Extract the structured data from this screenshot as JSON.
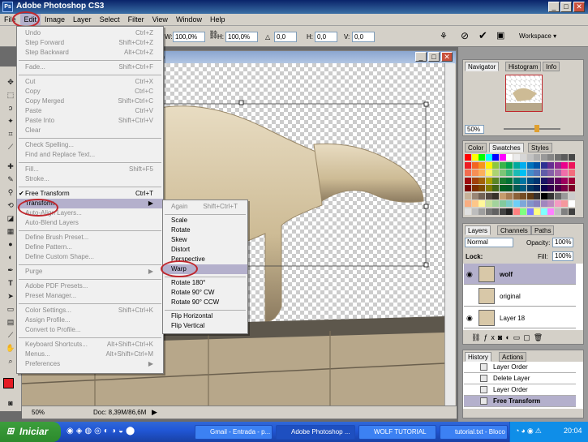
{
  "app": {
    "title": "Adobe Photoshop CS3",
    "ps_badge": "Ps"
  },
  "menubar": [
    "File",
    "Edit",
    "Image",
    "Layer",
    "Select",
    "Filter",
    "View",
    "Window",
    "Help"
  ],
  "options": {
    "w_label": "W:",
    "w_value": "100,0%",
    "h_label": "H:",
    "h_value": "100,0%",
    "angle_label": "△",
    "angle_value": "0,0",
    "hskew_label": "H:",
    "hskew_value": "0,0",
    "vskew_label": "V:",
    "vskew_value": "0,0",
    "workspace": "Workspace ▾"
  },
  "edit_menu": [
    {
      "label": "Undo",
      "sc": "Ctrl+Z",
      "en": false
    },
    {
      "label": "Step Forward",
      "sc": "Shift+Ctrl+Z",
      "en": false
    },
    {
      "label": "Step Backward",
      "sc": "Alt+Ctrl+Z",
      "en": false
    },
    {
      "sep": true
    },
    {
      "label": "Fade...",
      "sc": "Shift+Ctrl+F",
      "en": false
    },
    {
      "sep": true
    },
    {
      "label": "Cut",
      "sc": "Ctrl+X",
      "en": false
    },
    {
      "label": "Copy",
      "sc": "Ctrl+C",
      "en": false
    },
    {
      "label": "Copy Merged",
      "sc": "Shift+Ctrl+C",
      "en": false
    },
    {
      "label": "Paste",
      "sc": "Ctrl+V",
      "en": false
    },
    {
      "label": "Paste Into",
      "sc": "Shift+Ctrl+V",
      "en": false
    },
    {
      "label": "Clear",
      "sc": "",
      "en": false
    },
    {
      "sep": true
    },
    {
      "label": "Check Spelling...",
      "sc": "",
      "en": false
    },
    {
      "label": "Find and Replace Text...",
      "sc": "",
      "en": false
    },
    {
      "sep": true
    },
    {
      "label": "Fill...",
      "sc": "Shift+F5",
      "en": false
    },
    {
      "label": "Stroke...",
      "sc": "",
      "en": false
    },
    {
      "sep": true
    },
    {
      "label": "Free Transform",
      "sc": "Ctrl+T",
      "en": true,
      "check": true
    },
    {
      "label": "Transform",
      "sc": "▶",
      "en": true,
      "hl": true
    },
    {
      "label": "Auto-Align Layers...",
      "sc": "",
      "en": false
    },
    {
      "label": "Auto-Blend Layers",
      "sc": "",
      "en": false
    },
    {
      "sep": true
    },
    {
      "label": "Define Brush Preset...",
      "sc": "",
      "en": false
    },
    {
      "label": "Define Pattern...",
      "sc": "",
      "en": false
    },
    {
      "label": "Define Custom Shape...",
      "sc": "",
      "en": false
    },
    {
      "sep": true
    },
    {
      "label": "Purge",
      "sc": "▶",
      "en": false
    },
    {
      "sep": true
    },
    {
      "label": "Adobe PDF Presets...",
      "sc": "",
      "en": false
    },
    {
      "label": "Preset Manager...",
      "sc": "",
      "en": false
    },
    {
      "sep": true
    },
    {
      "label": "Color Settings...",
      "sc": "Shift+Ctrl+K",
      "en": false
    },
    {
      "label": "Assign Profile...",
      "sc": "",
      "en": false
    },
    {
      "label": "Convert to Profile...",
      "sc": "",
      "en": false
    },
    {
      "sep": true
    },
    {
      "label": "Keyboard Shortcuts...",
      "sc": "Alt+Shift+Ctrl+K",
      "en": false
    },
    {
      "label": "Menus...",
      "sc": "Alt+Shift+Ctrl+M",
      "en": false
    },
    {
      "label": "Preferences",
      "sc": "▶",
      "en": false
    }
  ],
  "transform_menu": [
    {
      "label": "Again",
      "sc": "Shift+Ctrl+T",
      "en": false
    },
    {
      "sep": true
    },
    {
      "label": "Scale",
      "en": true
    },
    {
      "label": "Rotate",
      "en": true
    },
    {
      "label": "Skew",
      "en": true
    },
    {
      "label": "Distort",
      "en": true
    },
    {
      "label": "Perspective",
      "en": true
    },
    {
      "label": "Warp",
      "en": true,
      "hl": true
    },
    {
      "sep": true
    },
    {
      "label": "Rotate 180°",
      "en": true
    },
    {
      "label": "Rotate 90° CW",
      "en": true
    },
    {
      "label": "Rotate 90° CCW",
      "en": true
    },
    {
      "sep": true
    },
    {
      "label": "Flip Horizontal",
      "en": true
    },
    {
      "label": "Flip Vertical",
      "en": true
    }
  ],
  "canvas": {
    "zoom": "50%",
    "doc": "Doc: 8,39M/86,6M",
    "tab_suffix": ")"
  },
  "navigator": {
    "tabs": [
      "Navigator",
      "Histogram",
      "Info"
    ],
    "zoom": "50%"
  },
  "color_panel": {
    "tabs": [
      "Color",
      "Swatches",
      "Styles"
    ]
  },
  "layers_panel": {
    "tabs": [
      "Layers",
      "Channels",
      "Paths"
    ],
    "blend": "Normal",
    "opacity_label": "Opacity:",
    "opacity": "100%",
    "lock_label": "Lock:",
    "fill_label": "Fill:",
    "fill": "100%",
    "layers": [
      {
        "name": "wolf",
        "selected": true
      },
      {
        "name": "original",
        "selected": false
      },
      {
        "name": "Layer 18",
        "selected": false
      }
    ]
  },
  "history_panel": {
    "tabs": [
      "History",
      "Actions"
    ],
    "items": [
      {
        "name": "Layer Order"
      },
      {
        "name": "Delete Layer"
      },
      {
        "name": "Layer Order"
      },
      {
        "name": "Free Transform",
        "bold": true
      }
    ]
  },
  "taskbar": {
    "start": "Iniciar",
    "tasks": [
      "Gmail - Entrada - p...",
      "Adobe Photoshop ...",
      "WOLF TUTORIAL",
      "tutorial.txt - Bloco ..."
    ],
    "clock": "20:04"
  },
  "colors": {
    "accent_circle": "#c0272d",
    "menu_highlight": "#b4b0cc"
  }
}
